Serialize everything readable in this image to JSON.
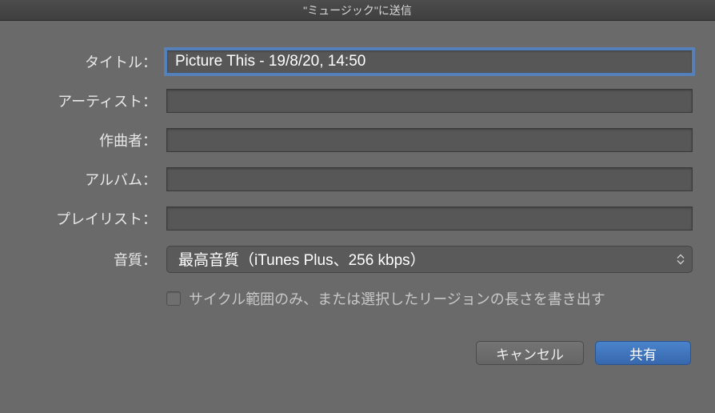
{
  "window": {
    "title": "\"ミュージック\"に送信"
  },
  "form": {
    "title": {
      "label": "タイトル：",
      "value": "Picture This - 19/8/20, 14:50"
    },
    "artist": {
      "label": "アーティスト：",
      "value": ""
    },
    "composer": {
      "label": "作曲者：",
      "value": ""
    },
    "album": {
      "label": "アルバム：",
      "value": ""
    },
    "playlist": {
      "label": "プレイリスト：",
      "value": ""
    },
    "quality": {
      "label": "音質：",
      "value": "最高音質（iTunes Plus、256 kbps）"
    },
    "export_range": {
      "label": "サイクル範囲のみ、または選択したリージョンの長さを書き出す",
      "checked": false
    }
  },
  "buttons": {
    "cancel": "キャンセル",
    "share": "共有"
  }
}
